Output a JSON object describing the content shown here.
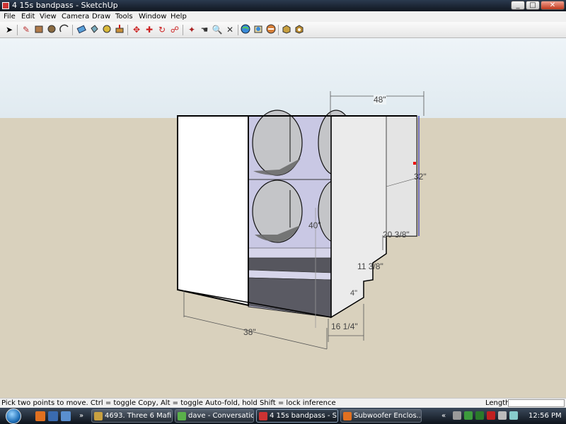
{
  "window": {
    "title": "4 15s bandpass - SketchUp",
    "minimize": "_",
    "maximize": "□",
    "close": "✕"
  },
  "menu": [
    "File",
    "Edit",
    "View",
    "Camera",
    "Draw",
    "Tools",
    "Window",
    "Help"
  ],
  "toolbar": {
    "icons": [
      "select-icon",
      "pencil-icon",
      "rectangle-icon",
      "circle-icon",
      "arc-icon",
      "eraser-icon",
      "paint-bucket-icon",
      "tape-measure-icon",
      "push-pull-icon",
      "move-icon",
      "rotate-icon",
      "offset-icon",
      "orbit-icon",
      "pan-icon",
      "zoom-icon",
      "zoom-extents-icon",
      "google-earth-icon",
      "get-models-icon",
      "share-model-icon",
      "component-icon",
      "get-photo-icon"
    ]
  },
  "dimensions": {
    "top_width": "48\"",
    "right_height": "32\"",
    "step_width": "20 3/8\"",
    "step_height": "11 3/8\"",
    "small_step": "4\"",
    "center_height": "40\"",
    "bottom_depth": "16 1/4\"",
    "front_width": "38\""
  },
  "colors": {
    "ground": "#d9d1bd",
    "sky": "#e6eef3",
    "face_white": "#ffffff",
    "face_shaded": "#c5c4e0",
    "face_dark": "#55555f",
    "dimension_blue": "#2b2bb0"
  },
  "status": {
    "hint": "Pick two points to move.  Ctrl = toggle Copy, Alt = toggle Auto-fold, hold Shift = lock inference",
    "length_label": "Length",
    "length_value": ""
  },
  "taskbar": {
    "tasks": [
      {
        "label": "4693. Three 6 Mafi...",
        "active": false
      },
      {
        "label": "dave - Conversation",
        "active": false
      },
      {
        "label": "4 15s bandpass - S...",
        "active": true
      },
      {
        "label": "Subwoofer Enclos...",
        "active": false
      }
    ],
    "clock": "12:56 PM",
    "tray_chevron": "«",
    "quicklaunch_chevron": "»"
  }
}
